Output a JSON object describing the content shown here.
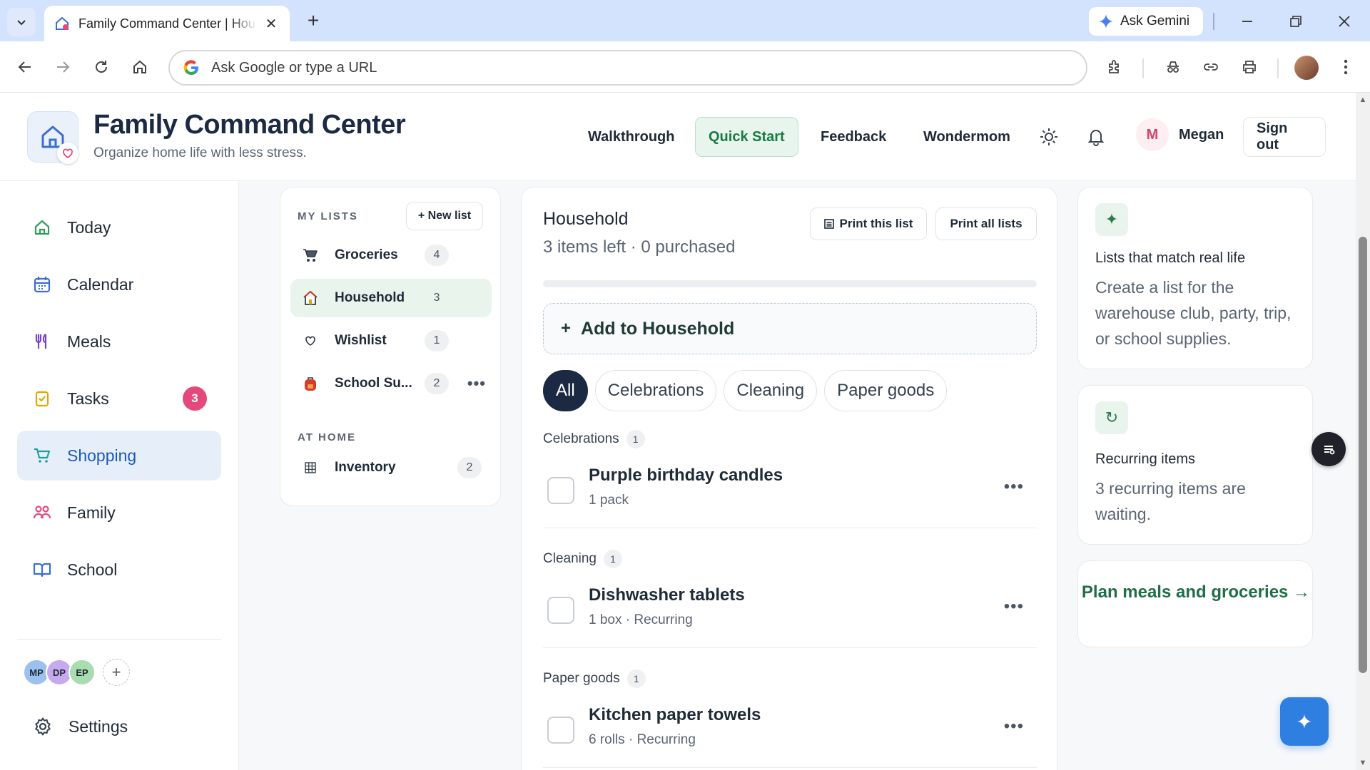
{
  "browser": {
    "tab_title": "Family Command Center | Household",
    "omnibox_placeholder": "Ask Google or type a URL",
    "gemini_label": "Ask Gemini"
  },
  "header": {
    "title": "Family Command Center",
    "subtitle": "Organize home life with less stress.",
    "nav": {
      "walkthrough": "Walkthrough",
      "quick_start": "Quick Start",
      "feedback": "Feedback",
      "wondermom": "Wondermom"
    },
    "user_initial": "M",
    "user_name": "Megan",
    "sign_out": "Sign out"
  },
  "sidebar": {
    "items": [
      {
        "label": "Today"
      },
      {
        "label": "Calendar"
      },
      {
        "label": "Meals"
      },
      {
        "label": "Tasks",
        "badge": "3"
      },
      {
        "label": "Shopping"
      },
      {
        "label": "Family"
      },
      {
        "label": "School"
      }
    ],
    "family_members": [
      "MP",
      "DP",
      "EP"
    ],
    "add_member": "+",
    "settings": "Settings"
  },
  "lists": {
    "my_lists_heading": "MY LISTS",
    "new_list": "+ New list",
    "items": [
      {
        "name": "Groceries",
        "count": "4"
      },
      {
        "name": "Household",
        "count": "3"
      },
      {
        "name": "Wishlist",
        "count": "1"
      },
      {
        "name": "School Su...",
        "count": "2"
      }
    ],
    "at_home_heading": "AT HOME",
    "at_home_items": [
      {
        "name": "Inventory",
        "count": "2"
      }
    ]
  },
  "main": {
    "title": "Household",
    "summary": "3 items left · 0 purchased",
    "progress": 0,
    "print_this": "Print this list",
    "print_all": "Print all lists",
    "add_label": "Add to Household",
    "filters": [
      "All",
      "Celebrations",
      "Cleaning",
      "Paper goods"
    ],
    "groups": [
      {
        "name": "Celebrations",
        "count": "1",
        "item": {
          "name": "Purple birthday candles",
          "meta": "1 pack"
        }
      },
      {
        "name": "Cleaning",
        "count": "1",
        "item": {
          "name": "Dishwasher tablets",
          "meta": "1 box · Recurring"
        }
      },
      {
        "name": "Paper goods",
        "count": "1",
        "item": {
          "name": "Kitchen paper towels",
          "meta": "6 rolls · Recurring"
        }
      }
    ]
  },
  "tips": {
    "card1_title": "Lists that match real life",
    "card1_body": "Create a list for the warehouse club, party, trip, or school supplies.",
    "card2_title": "Recurring items",
    "card2_body": "3 recurring items are waiting.",
    "plan_link": "Plan meals and groceries →"
  }
}
